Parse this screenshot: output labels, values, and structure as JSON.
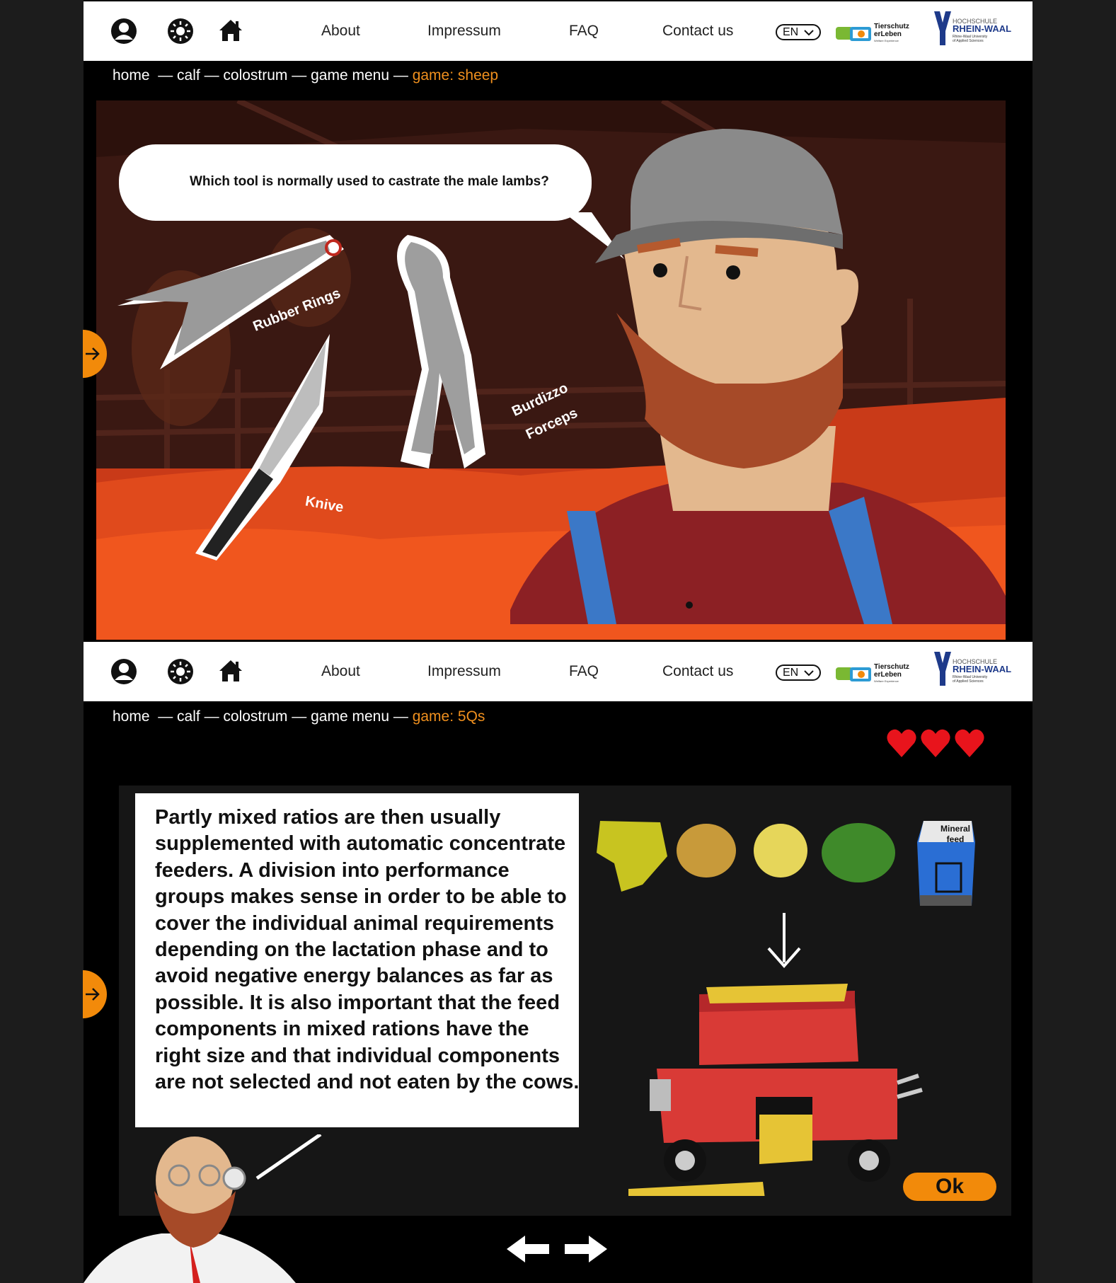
{
  "nav": {
    "about": "About",
    "impressum": "Impressum",
    "faq": "FAQ",
    "contact": "Contact us",
    "language": "EN"
  },
  "logos": {
    "tierschutz_line1": "Tierschutz",
    "tierschutz_line2": "erLeben",
    "tierschutz_sub": "Welfare Experience",
    "hochschule": "HOCHSCHULE",
    "rheinwaal": "RHEIN-WAAL",
    "rheinwaal_sub1": "Rhine-Waal University",
    "rheinwaal_sub2": "of Applied Sciences"
  },
  "screen1": {
    "breadcrumb": {
      "home": "home",
      "calf": "— calf",
      "colostrum": "— colostrum",
      "menu": "— game menu",
      "dash": "—",
      "current": "game: sheep"
    },
    "question": "Which tool is normally used to castrate the male lambs?",
    "tools": {
      "rings": "Rubber Rings",
      "knive": "Knive",
      "burdizzo": "Burdizzo",
      "forceps": "Forceps"
    }
  },
  "screen2": {
    "breadcrumb": {
      "home": "home",
      "calf": "— calf",
      "colostrum": "— colostrum",
      "menu": "— game menu",
      "dash": "—",
      "current": "game: 5Qs"
    },
    "lives": 3,
    "text": "Partly mixed ratios are then usually supplemented with automatic concentrate feeders. A division into performance groups makes sense in order to be able to cover the individual animal requirements depending on the lactation phase and to avoid negative energy balances as far as possible. It is also important that the feed components in mixed rations have the right size and that individual components are not selected and not eaten by the cows.",
    "mineral_line1": "Mineral",
    "mineral_line2": "feed",
    "ok": "Ok"
  },
  "colors": {
    "accent": "#f28a0a",
    "breadcrumb_current": "#f0901e",
    "heart": "#e8141c",
    "cart": "#d93a36"
  }
}
